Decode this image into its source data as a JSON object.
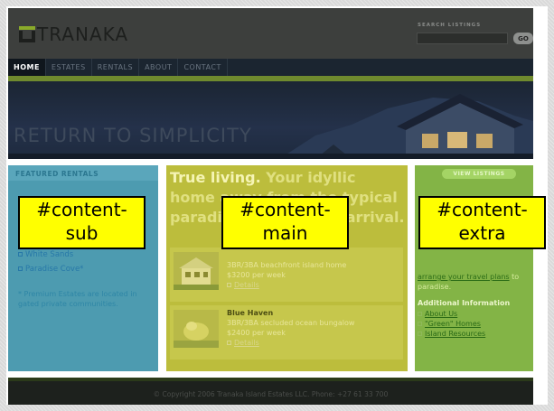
{
  "header": {
    "logo_text": "TRANAKA",
    "search_label": "SEARCH LISTINGS",
    "search_value": "",
    "go_label": "GO"
  },
  "nav": {
    "items": [
      {
        "label": "HOME",
        "active": true
      },
      {
        "label": "ESTATES",
        "active": false
      },
      {
        "label": "RENTALS",
        "active": false
      },
      {
        "label": "ABOUT",
        "active": false
      },
      {
        "label": "CONTACT",
        "active": false
      }
    ]
  },
  "hero": {
    "tagline": "RETURN TO SIMPLICITY"
  },
  "content_sub": {
    "heading": "FEATURED RENTALS",
    "links": [
      "White Sands",
      "Paradise Cove*"
    ],
    "note": "* Premium Estates are located in gated private communities."
  },
  "content_main": {
    "heading_strong": "True living.",
    "heading_rest": " Your idyllic home away from the typical paradise awaits your arrival.",
    "listings": [
      {
        "title": "",
        "desc": "3BR/3BA beachfront island home",
        "price": "$3200 per week",
        "details": "Details"
      },
      {
        "title": "Blue Haven",
        "desc": "3BR/3BA secluded ocean bungalow",
        "price": "$2400 per week",
        "details": "Details"
      }
    ]
  },
  "content_extra": {
    "button": "VIEW LISTINGS",
    "text_link": "arrange your travel plans",
    "text_rest": " to paradise.",
    "subheading": "Additional Information",
    "links": [
      "About Us",
      "\"Green\" Homes",
      "Island Resources"
    ]
  },
  "overlays": {
    "sub": {
      "line1": "#content-",
      "line2": "sub"
    },
    "main": {
      "line1": "#content-",
      "line2": "main"
    },
    "extra": {
      "line1": "#content-",
      "line2": "extra"
    }
  },
  "footer": {
    "text": "© Copyright 2006 Tranaka Island Estates LLC. Phone: +27 61 33 700"
  },
  "colors": {
    "content_sub": "#4d9bb0",
    "content_main": "#bcbd3c",
    "content_extra": "#83b446",
    "overlay": "#ffff00"
  }
}
